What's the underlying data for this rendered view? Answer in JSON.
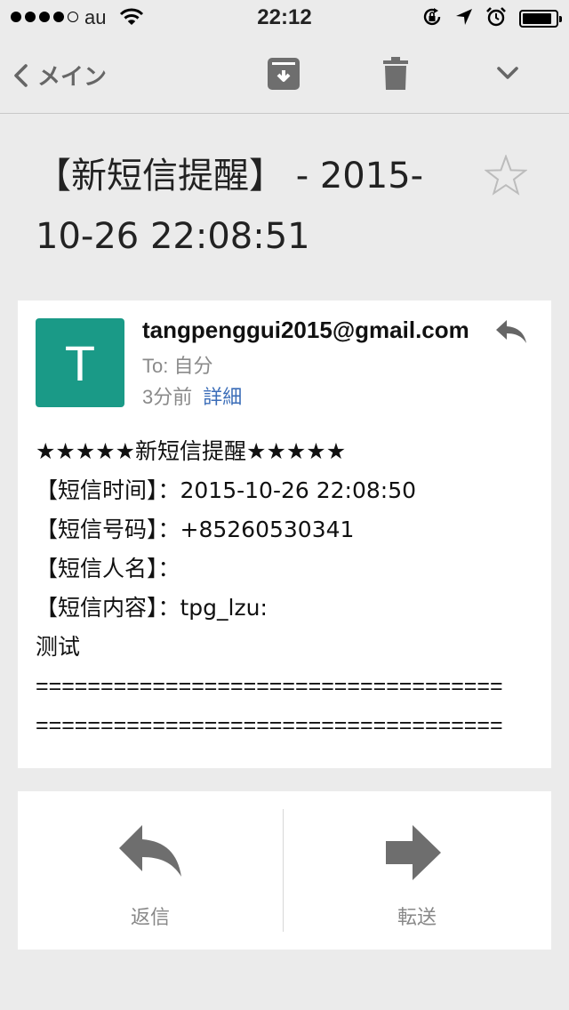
{
  "status_bar": {
    "carrier": "au",
    "time": "22:12",
    "signal_bars": 4,
    "signal_total": 5,
    "battery_level": 0.9
  },
  "toolbar": {
    "back_label": "メイン",
    "icons": [
      "back-chevron-icon",
      "archive-icon",
      "trash-icon",
      "chevron-down-icon"
    ]
  },
  "message": {
    "subject": "【新短信提醒】 - 2015-10-26 22:08:51",
    "starred": false,
    "avatar_letter": "T",
    "avatar_color": "#1a9a87",
    "sender": "tangpenggui2015@gmail.com",
    "to_line": "To: 自分",
    "time_ago": "3分前",
    "details_link": "詳細",
    "link_color": "#3b6db8",
    "body_lines": [
      "★★★★★新短信提醒★★★★★",
      "【短信时间】：2015-10-26 22:08:50",
      "【短信号码】：+85260530341",
      "【短信人名】：",
      "【短信内容】：tpg_lzu:",
      "测试",
      "====================================",
      "===================================="
    ]
  },
  "actions": {
    "reply_label": "返信",
    "forward_label": "転送"
  }
}
